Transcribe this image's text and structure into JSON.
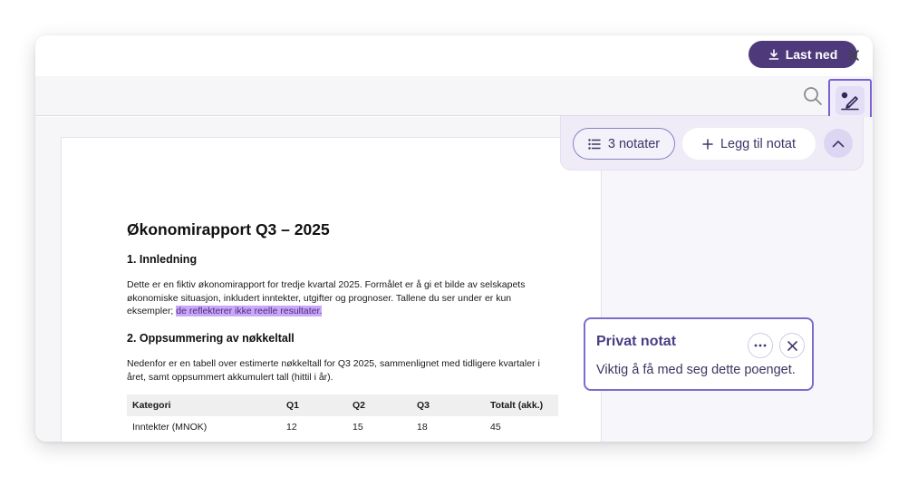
{
  "header": {
    "download_label": "Last ned"
  },
  "notes_bar": {
    "count_label": "3 notater",
    "add_label": "Legg til notat"
  },
  "document": {
    "title": "Økonomirapport Q3 – 2025",
    "section1_heading": "1. Innledning",
    "section1_text": "Dette er en fiktiv økonomirapport for tredje kvartal 2025. Formålet er å gi et bilde av selskapets økonomiske situasjon, inkludert inntekter, utgifter og prognoser. Tallene du ser under er kun eksempler; ",
    "section1_highlight": "de reflekterer ikke reelle resultater.",
    "section2_heading": "2. Oppsummering av nøkkeltall",
    "section2_text": "Nedenfor er en tabell over estimerte nøkkeltall for Q3 2025, sammenlignet med tidligere kvartaler i året, samt oppsummert akkumulert tall (hittil i år).",
    "table": {
      "headers": [
        "Kategori",
        "Q1",
        "Q2",
        "Q3",
        "Totalt (akk.)"
      ],
      "rows": [
        [
          "Inntekter (MNOK)",
          "12",
          "15",
          "18",
          "45"
        ]
      ]
    }
  },
  "note": {
    "title": "Privat notat",
    "text": "Viktig å få med seg dette poenget."
  },
  "colors": {
    "accent": "#4e3a7a",
    "highlight": "#c9a8f5",
    "note_border": "#7f6bcc"
  },
  "icons": {
    "download": "download-icon",
    "close": "close-icon",
    "search": "search-icon",
    "annotate": "annotate-pen-icon",
    "list": "list-icon",
    "plus": "plus-icon",
    "chevron": "chevron-up-icon",
    "more": "more-horizontal-icon"
  }
}
